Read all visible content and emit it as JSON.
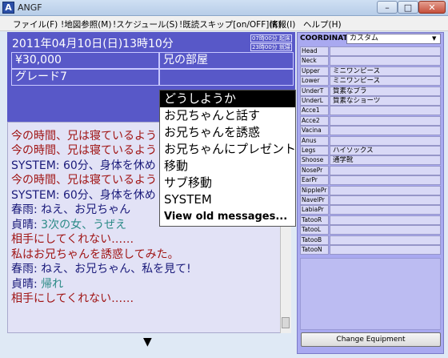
{
  "window": {
    "icon_letter": "A",
    "title": "ANGF",
    "minimize": "–",
    "maximize": "□",
    "close": "✕"
  },
  "menubar": [
    "ファイル(F)",
    "!地図参照(M)",
    "!スケジュール(S)",
    "!既読スキップ[on/OFF](K)",
    "情報(I)",
    "ヘルプ(H)"
  ],
  "status": {
    "datetime": "2011年04月10日(日)13時10分",
    "badge_1": "07時00分 起床",
    "badge_2": "23時00分 就寝",
    "money": "¥30,000",
    "location": "兄の部屋",
    "grade": "グレード7"
  },
  "log": [
    {
      "text": "今の時間、兄は寝ているよう",
      "color": "red"
    },
    {
      "text": "今の時間、兄は寝ているよう",
      "color": "red"
    },
    {
      "text": "SYSTEM: 60分、身体を休め",
      "color": "blue"
    },
    {
      "text": "今の時間、兄は寝ているよう",
      "color": "red"
    },
    {
      "text": "SYSTEM: 60分、身体を休め",
      "color": "blue"
    },
    {
      "text": "春雨: ねえ、お兄ちゃん",
      "color": "blue"
    },
    {
      "speaker": "貞晴: ",
      "text": "3次の女、うぜえ",
      "color": "teal"
    },
    {
      "text": "相手にしてくれない……",
      "color": "red"
    },
    {
      "text": "私はお兄ちゃんを誘惑してみた。",
      "color": "red"
    },
    {
      "text": "春雨: ねえ、お兄ちゃん、私を見て!",
      "color": "blue"
    },
    {
      "speaker": "貞晴: ",
      "text": "帰れ",
      "color": "teal"
    },
    {
      "text": "相手にしてくれない……",
      "color": "red"
    }
  ],
  "more_indicator": "▼",
  "command_menu": {
    "items": [
      "どうしようか",
      "お兄ちゃんと話す",
      "お兄ちゃんを誘惑",
      "お兄ちゃんにプレゼント",
      "移動",
      "サブ移動",
      "SYSTEM",
      "View old messages..."
    ],
    "selected_index": 0
  },
  "equipment": {
    "coordinate_label": "COORDINATE:",
    "coordinate_value": "カスタム",
    "slots": [
      {
        "slot": "Head",
        "item": ""
      },
      {
        "slot": "Neck",
        "item": ""
      },
      {
        "slot": "Upper",
        "item": "ミニワンピース"
      },
      {
        "slot": "Lower",
        "item": "ミニワンピース"
      },
      {
        "slot": "UnderT",
        "item": "質素なブラ"
      },
      {
        "slot": "UnderL",
        "item": "質素なショーツ"
      },
      {
        "slot": "Acce1",
        "item": ""
      },
      {
        "slot": "Acce2",
        "item": ""
      },
      {
        "slot": "Vacina",
        "item": ""
      },
      {
        "slot": "Anus",
        "item": ""
      },
      {
        "slot": "Legs",
        "item": "ハイソックス"
      },
      {
        "slot": "Shoose",
        "item": "通学靴"
      },
      {
        "slot": "NosePr",
        "item": ""
      },
      {
        "slot": "EarPr",
        "item": ""
      },
      {
        "slot": "NipplePr",
        "item": ""
      },
      {
        "slot": "NavelPr",
        "item": ""
      },
      {
        "slot": "LabiaPr",
        "item": ""
      },
      {
        "slot": "TatooR",
        "item": ""
      },
      {
        "slot": "TatooL",
        "item": ""
      },
      {
        "slot": "TatooB",
        "item": ""
      },
      {
        "slot": "TatooN",
        "item": ""
      }
    ],
    "change_button": "Change Equipment"
  },
  "colors": {
    "info_bg": "#5858c8",
    "panel_bg": "#a9a9f0",
    "log_bg": "#e2e2f6",
    "log_red": "#a01414",
    "log_blue": "#1a1a7a",
    "log_teal": "#2a8a86"
  }
}
